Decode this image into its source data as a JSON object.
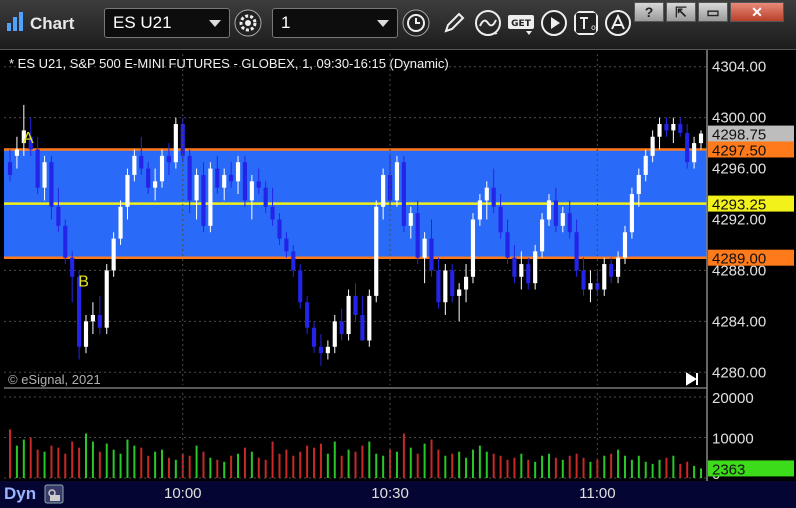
{
  "toolbar": {
    "title": "Chart",
    "symbol": "ES U21",
    "interval": "1",
    "icons": [
      "chart-app-icon",
      "settings-gear-icon",
      "clock-icon",
      "pencil-icon",
      "study-icon",
      "get-icon",
      "play-icon",
      "text-tool-icon",
      "alert-icon",
      "restore-icon",
      "maximize-icon",
      "close-icon"
    ]
  },
  "chart_data": [
    {
      "type": "candlestick",
      "title": "* ES U21, S&P 500 E-MINI FUTURES - GLOBEX, 1, 09:30-16:15 (Dynamic)",
      "copyright": "© eSignal, 2021",
      "ylim": [
        4279,
        4305
      ],
      "y_ticks": [
        "4304.00",
        "4300.00",
        "4296.00",
        "4292.00",
        "4288.00",
        "4284.00",
        "4280.00"
      ],
      "x_ticks": [
        {
          "label": "10:00",
          "bar": 25
        },
        {
          "label": "10:30",
          "bar": 55
        },
        {
          "label": "11:00",
          "bar": 85
        }
      ],
      "range_band": {
        "from": 4289.0,
        "to": 4297.5,
        "color": "#2a6af8"
      },
      "horizontal_lines": [
        {
          "value": 4297.5,
          "label": "4297.50",
          "color": "#ff7a1a"
        },
        {
          "value": 4293.25,
          "label": "4293.25",
          "color": "#f2f21a"
        },
        {
          "value": 4289.0,
          "label": "4289.00",
          "color": "#ff7a1a"
        }
      ],
      "last_price": {
        "value": 4298.75,
        "label": "4298.75"
      },
      "annotations": [
        {
          "text": "A",
          "bar": 1,
          "y": 4298.5,
          "color": "#e6e61a"
        },
        {
          "text": "B",
          "bar": 9,
          "y": 4287.2,
          "color": "#e6e61a"
        }
      ],
      "candles": [
        [
          4296.5,
          4297.5,
          4295.0,
          4295.5
        ],
        [
          4297.0,
          4298.5,
          4296.0,
          4297.5
        ],
        [
          4298.0,
          4301.0,
          4297.0,
          4299.0
        ],
        [
          4298.5,
          4300.0,
          4297.0,
          4297.5
        ],
        [
          4297.5,
          4298.5,
          4294.0,
          4294.5
        ],
        [
          4294.5,
          4297.0,
          4293.5,
          4296.5
        ],
        [
          4296.5,
          4297.0,
          4292.0,
          4293.0
        ],
        [
          4293.0,
          4294.5,
          4291.0,
          4291.5
        ],
        [
          4291.5,
          4292.0,
          4288.5,
          4289.0
        ],
        [
          4289.0,
          4289.5,
          4285.5,
          4287.5
        ],
        [
          4287.5,
          4288.0,
          4281.0,
          4282.0
        ],
        [
          4282.0,
          4284.5,
          4281.5,
          4284.0
        ],
        [
          4284.0,
          4285.5,
          4283.0,
          4284.5
        ],
        [
          4284.5,
          4286.0,
          4283.0,
          4283.5
        ],
        [
          4283.5,
          4288.5,
          4283.0,
          4288.0
        ],
        [
          4288.0,
          4291.0,
          4287.5,
          4290.5
        ],
        [
          4290.5,
          4293.5,
          4290.0,
          4293.0
        ],
        [
          4293.0,
          4296.0,
          4292.0,
          4295.5
        ],
        [
          4295.5,
          4297.5,
          4295.0,
          4297.0
        ],
        [
          4297.0,
          4298.5,
          4295.5,
          4296.0
        ],
        [
          4296.0,
          4296.5,
          4294.0,
          4294.5
        ],
        [
          4294.5,
          4296.0,
          4293.5,
          4295.0
        ],
        [
          4295.0,
          4297.5,
          4294.5,
          4297.0
        ],
        [
          4297.0,
          4298.0,
          4295.5,
          4296.5
        ],
        [
          4296.5,
          4300.0,
          4296.0,
          4299.5
        ],
        [
          4299.5,
          4300.0,
          4296.5,
          4297.0
        ],
        [
          4297.0,
          4297.5,
          4292.5,
          4293.5
        ],
        [
          4293.5,
          4296.0,
          4292.0,
          4295.5
        ],
        [
          4295.5,
          4296.5,
          4291.0,
          4291.5
        ],
        [
          4291.5,
          4296.5,
          4291.0,
          4296.0
        ],
        [
          4296.0,
          4297.0,
          4294.0,
          4294.5
        ],
        [
          4294.5,
          4296.0,
          4293.5,
          4295.5
        ],
        [
          4295.5,
          4296.5,
          4294.5,
          4295.0
        ],
        [
          4295.0,
          4297.0,
          4294.0,
          4296.5
        ],
        [
          4296.5,
          4297.0,
          4293.0,
          4293.5
        ],
        [
          4293.5,
          4295.5,
          4292.0,
          4295.0
        ],
        [
          4295.0,
          4296.0,
          4294.0,
          4294.5
        ],
        [
          4294.5,
          4295.0,
          4292.5,
          4293.0
        ],
        [
          4293.0,
          4294.5,
          4291.5,
          4292.0
        ],
        [
          4292.0,
          4292.5,
          4290.0,
          4290.5
        ],
        [
          4290.5,
          4291.0,
          4289.0,
          4289.5
        ],
        [
          4289.5,
          4290.0,
          4287.5,
          4288.0
        ],
        [
          4288.0,
          4288.5,
          4285.0,
          4285.5
        ],
        [
          4285.5,
          4286.0,
          4283.0,
          4283.5
        ],
        [
          4283.5,
          4284.0,
          4281.5,
          4282.0
        ],
        [
          4282.0,
          4283.0,
          4280.5,
          4281.5
        ],
        [
          4281.5,
          4282.5,
          4281.0,
          4282.0
        ],
        [
          4282.0,
          4284.5,
          4281.5,
          4284.0
        ],
        [
          4284.0,
          4285.0,
          4282.5,
          4283.0
        ],
        [
          4283.0,
          4286.5,
          4282.5,
          4286.0
        ],
        [
          4286.0,
          4287.0,
          4284.0,
          4284.5
        ],
        [
          4284.5,
          4286.0,
          4283.0,
          4282.5
        ],
        [
          4282.5,
          4286.5,
          4282.0,
          4286.0
        ],
        [
          4286.0,
          4293.5,
          4285.5,
          4293.0
        ],
        [
          4293.0,
          4296.0,
          4292.0,
          4295.5
        ],
        [
          4295.5,
          4297.0,
          4293.0,
          4293.5
        ],
        [
          4293.5,
          4297.0,
          4293.0,
          4296.5
        ],
        [
          4296.5,
          4297.0,
          4291.0,
          4291.5
        ],
        [
          4291.5,
          4293.0,
          4290.5,
          4292.5
        ],
        [
          4292.5,
          4293.5,
          4288.5,
          4289.0
        ],
        [
          4289.0,
          4291.0,
          4287.0,
          4290.5
        ],
        [
          4290.5,
          4292.0,
          4287.5,
          4288.0
        ],
        [
          4288.0,
          4289.0,
          4285.0,
          4285.5
        ],
        [
          4285.5,
          4288.5,
          4284.5,
          4288.0
        ],
        [
          4288.0,
          4288.5,
          4285.5,
          4286.0
        ],
        [
          4286.0,
          4287.0,
          4284.0,
          4286.5
        ],
        [
          4286.5,
          4288.5,
          4285.5,
          4287.5
        ],
        [
          4287.5,
          4292.5,
          4287.0,
          4292.0
        ],
        [
          4292.0,
          4294.0,
          4291.5,
          4293.5
        ],
        [
          4293.5,
          4295.0,
          4292.0,
          4294.5
        ],
        [
          4294.5,
          4296.0,
          4292.5,
          4293.0
        ],
        [
          4293.0,
          4294.0,
          4290.5,
          4291.0
        ],
        [
          4291.0,
          4292.0,
          4288.5,
          4289.0
        ],
        [
          4289.0,
          4290.0,
          4287.0,
          4287.5
        ],
        [
          4287.5,
          4289.5,
          4286.5,
          4288.5
        ],
        [
          4288.5,
          4289.0,
          4286.5,
          4287.0
        ],
        [
          4287.0,
          4290.0,
          4286.5,
          4289.5
        ],
        [
          4289.5,
          4292.5,
          4289.0,
          4292.0
        ],
        [
          4292.0,
          4294.0,
          4291.5,
          4293.5
        ],
        [
          4293.5,
          4294.5,
          4291.0,
          4291.5
        ],
        [
          4291.5,
          4293.0,
          4291.0,
          4292.5
        ],
        [
          4292.5,
          4293.5,
          4290.5,
          4291.0
        ],
        [
          4291.0,
          4292.0,
          4287.5,
          4288.0
        ],
        [
          4288.0,
          4289.0,
          4286.0,
          4286.5
        ],
        [
          4286.5,
          4288.0,
          4285.5,
          4287.0
        ],
        [
          4287.0,
          4288.0,
          4286.0,
          4286.5
        ],
        [
          4286.5,
          4289.0,
          4286.0,
          4288.5
        ],
        [
          4288.5,
          4289.0,
          4287.0,
          4287.5
        ],
        [
          4287.5,
          4289.5,
          4287.0,
          4289.0
        ],
        [
          4289.0,
          4291.5,
          4288.5,
          4291.0
        ],
        [
          4291.0,
          4294.5,
          4290.5,
          4294.0
        ],
        [
          4294.0,
          4296.0,
          4293.0,
          4295.5
        ],
        [
          4295.5,
          4297.5,
          4295.0,
          4297.0
        ],
        [
          4297.0,
          4299.0,
          4296.5,
          4298.5
        ],
        [
          4298.5,
          4300.0,
          4297.5,
          4299.5
        ],
        [
          4299.5,
          4300.0,
          4298.5,
          4299.0
        ],
        [
          4299.0,
          4300.0,
          4298.0,
          4299.5
        ],
        [
          4299.5,
          4300.0,
          4298.5,
          4298.8
        ],
        [
          4298.8,
          4299.5,
          4296.0,
          4296.5
        ],
        [
          4296.5,
          4298.5,
          4296.0,
          4298.0
        ],
        [
          4298.0,
          4299.0,
          4297.5,
          4298.75
        ]
      ],
      "volume": {
        "ylim": [
          0,
          21000
        ],
        "y_ticks": [
          "20000",
          "10000",
          "0"
        ],
        "last_volume": "2363",
        "values": [
          12000,
          8000,
          9500,
          10000,
          7000,
          6500,
          8000,
          7500,
          6000,
          9000,
          7500,
          11000,
          9000,
          6500,
          8500,
          7000,
          6000,
          9500,
          8000,
          7500,
          5500,
          6500,
          7000,
          5000,
          4500,
          6000,
          5500,
          8000,
          6500,
          5000,
          4500,
          4000,
          5500,
          6000,
          7500,
          6500,
          5000,
          4500,
          9000,
          6000,
          7000,
          5500,
          6500,
          8000,
          7500,
          8500,
          6000,
          9000,
          5500,
          7000,
          6500,
          8000,
          9000,
          6000,
          5500,
          7000,
          6500,
          11000,
          7500,
          6000,
          8500,
          9500,
          7000,
          5500,
          6000,
          6500,
          5000,
          7000,
          8000,
          6500,
          6000,
          5500,
          4500,
          5000,
          6000,
          4500,
          4000,
          5500,
          6000,
          5000,
          4500,
          5500,
          6000,
          5000,
          4000,
          4500,
          5500,
          6000,
          7000,
          5500,
          4500,
          5500,
          4000,
          3500,
          4500,
          5000,
          5500,
          3500,
          4000,
          3000,
          2363
        ]
      }
    }
  ],
  "axis_labels": {
    "volume_badge": "2363"
  },
  "bottom": {
    "mode": "Dyn"
  }
}
